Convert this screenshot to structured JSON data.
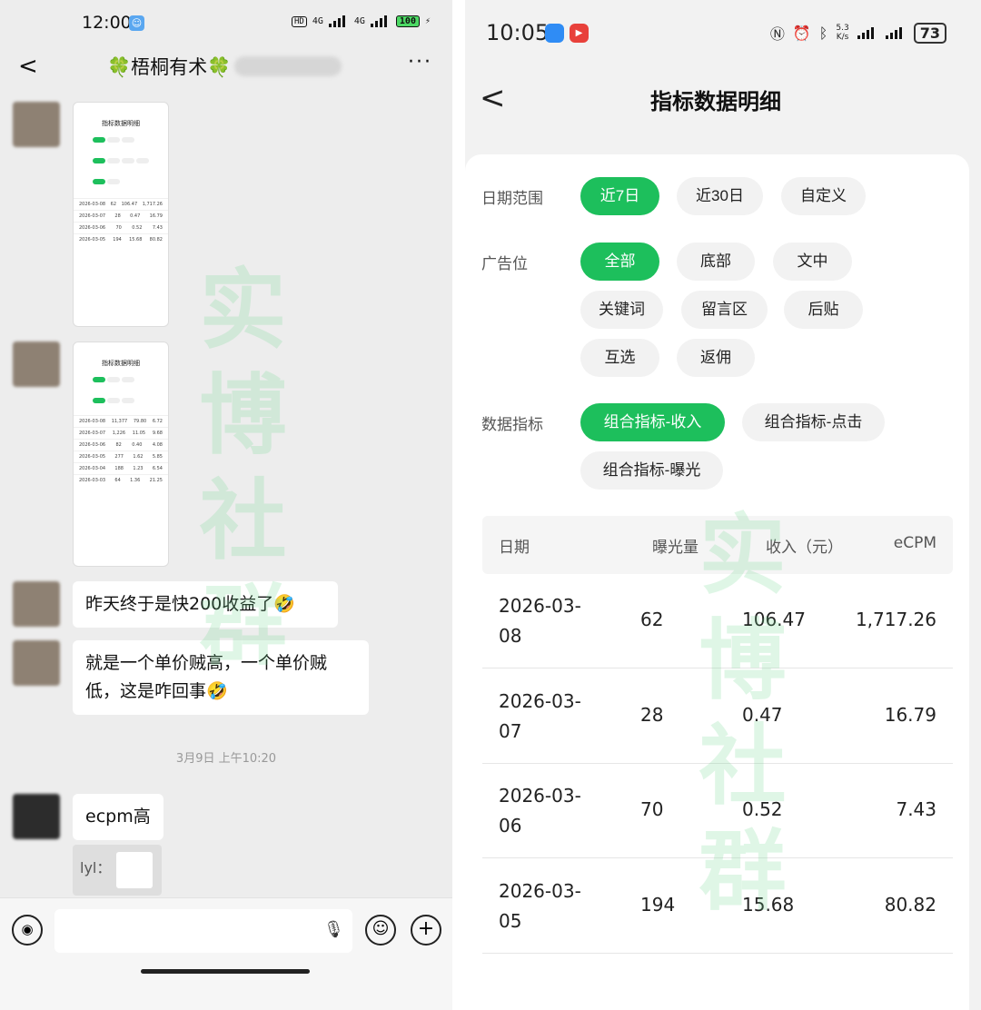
{
  "left": {
    "status": {
      "time": "12:00",
      "network1": "4G",
      "network2": "4G",
      "battery": "100"
    },
    "chat_title": "🍀梧桐有术🍀",
    "messages": [
      {
        "type": "image"
      },
      {
        "type": "image"
      },
      {
        "type": "text",
        "text": "昨天终于是快200收益了🤣"
      },
      {
        "type": "text",
        "text": "就是一个单价贼高，一个单价贼低，这是咋回事🤣"
      }
    ],
    "timestamp": "3月9日 上午10:20",
    "reply": {
      "text": "ecpm高",
      "quote_name": "lyl："
    },
    "thumb1": {
      "title": "指标数据明细",
      "rows": [
        [
          "2026-03-08",
          "62",
          "106.47",
          "1,717.26"
        ],
        [
          "2026-03-07",
          "28",
          "0.47",
          "16.79"
        ],
        [
          "2026-03-06",
          "70",
          "0.52",
          "7.43"
        ],
        [
          "2026-03-05",
          "194",
          "15.68",
          "80.82"
        ]
      ]
    },
    "thumb2": {
      "title": "指标数据明细",
      "rows": [
        [
          "2026-03-08",
          "11,377",
          "79.80",
          "6.72"
        ],
        [
          "2026-03-07",
          "1,226",
          "11.05",
          "9.68"
        ],
        [
          "2026-03-06",
          "82",
          "0.40",
          "4.08"
        ],
        [
          "2026-03-05",
          "277",
          "1.62",
          "5.85"
        ],
        [
          "2026-03-04",
          "188",
          "1.23",
          "6.54"
        ],
        [
          "2026-03-03",
          "64",
          "1.36",
          "21.25"
        ]
      ]
    }
  },
  "right": {
    "status": {
      "time": "10:05",
      "speed_top": "5.3",
      "speed_bottom": "K/s",
      "battery": "73"
    },
    "page_title": "指标数据明细",
    "date_range": {
      "label": "日期范围",
      "options": [
        "近7日",
        "近30日",
        "自定义"
      ],
      "selected": 0
    },
    "ad_slot": {
      "label": "广告位",
      "options": [
        "全部",
        "底部",
        "文中",
        "关键词",
        "留言区",
        "后贴",
        "互选",
        "返佣"
      ],
      "selected": 0
    },
    "metric": {
      "label": "数据指标",
      "options": [
        "组合指标-收入",
        "组合指标-点击",
        "组合指标-曝光"
      ],
      "selected": 0
    },
    "table": {
      "headers": [
        "日期",
        "曝光量",
        "收入（元）",
        "eCPM"
      ],
      "rows": [
        {
          "date": "2026-03-08",
          "impressions": "62",
          "revenue": "106.47",
          "ecpm": "1,717.26"
        },
        {
          "date": "2026-03-07",
          "impressions": "28",
          "revenue": "0.47",
          "ecpm": "16.79"
        },
        {
          "date": "2026-03-06",
          "impressions": "70",
          "revenue": "0.52",
          "ecpm": "7.43"
        },
        {
          "date": "2026-03-05",
          "impressions": "194",
          "revenue": "15.68",
          "ecpm": "80.82"
        }
      ]
    },
    "watermark": "实博社群"
  },
  "colors": {
    "accent": "#1dbf5c",
    "chat_bg": "#ededed",
    "page_bg": "#f2f2f2"
  }
}
